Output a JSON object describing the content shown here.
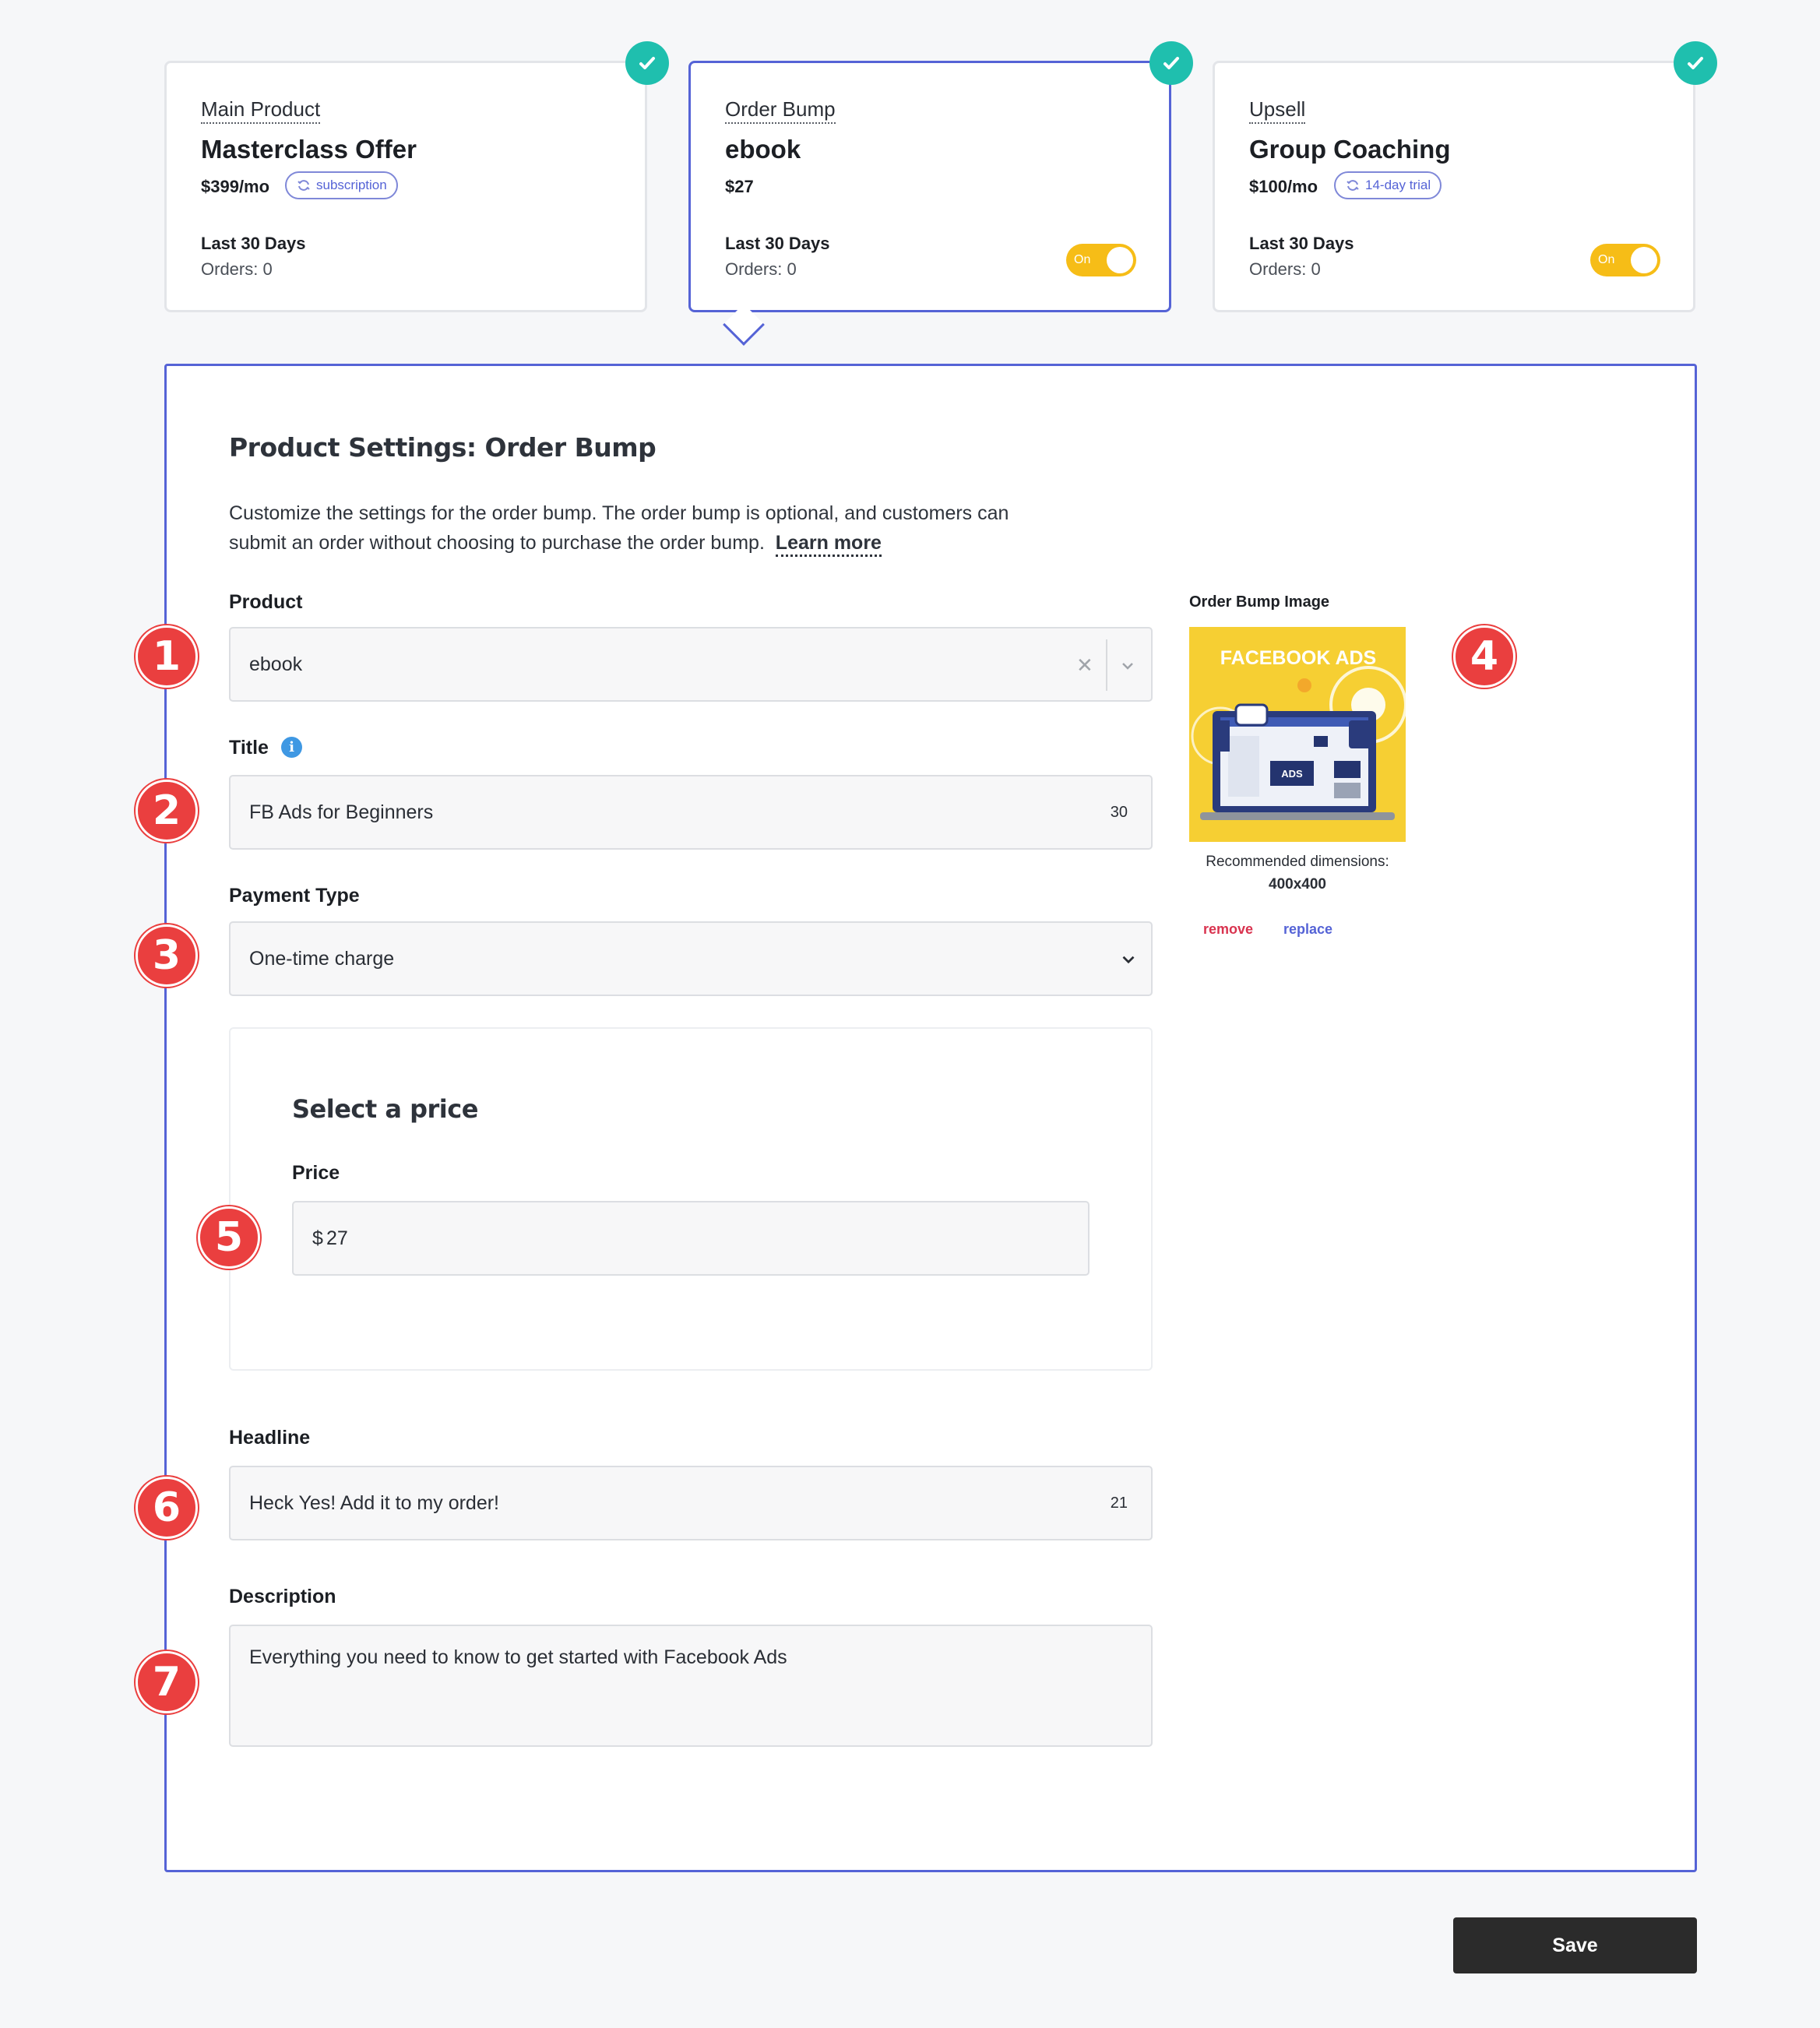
{
  "cards": [
    {
      "kind": "Main Product",
      "name": "Masterclass Offer",
      "price": "$399/mo",
      "tag": "subscription",
      "period": "Last 30 Days",
      "orders": "Orders: 0"
    },
    {
      "kind": "Order Bump",
      "name": "ebook",
      "price": "$27",
      "period": "Last 30 Days",
      "orders": "Orders: 0",
      "toggle": "On"
    },
    {
      "kind": "Upsell",
      "name": "Group Coaching",
      "price": "$100/mo",
      "tag": "14-day trial",
      "period": "Last 30 Days",
      "orders": "Orders: 0",
      "toggle": "On"
    }
  ],
  "settings": {
    "title": "Product Settings: Order Bump",
    "intro_line1": "Customize the settings for the order bump. The order bump is optional, and customers can",
    "intro_line2": "submit an order without choosing to purchase the order bump.",
    "learn_more": "Learn more"
  },
  "form": {
    "product_label": "Product",
    "product_value": "ebook",
    "title_label": "Title",
    "title_value": "FB Ads for Beginners",
    "title_count": "30",
    "payment_label": "Payment Type",
    "payment_value": "One-time charge",
    "price_section_title": "Select a price",
    "price_label": "Price",
    "price_currency": "$",
    "price_value": "27",
    "headline_label": "Headline",
    "headline_value": "Heck Yes! Add it to my order!",
    "headline_count": "21",
    "description_label": "Description",
    "description_value": "Everything you need to know to get started with Facebook Ads"
  },
  "image": {
    "label": "Order Bump Image",
    "banner_text": "FACEBOOK ADS",
    "ads_label": "ADS",
    "rec_line1": "Recommended dimensions:",
    "rec_line2": "400x400",
    "remove": "remove",
    "replace": "replace"
  },
  "markers": [
    "1",
    "2",
    "3",
    "4",
    "5",
    "6",
    "7"
  ],
  "save_label": "Save",
  "colors": {
    "accent": "#5563d6",
    "check": "#1fbfae",
    "toggle": "#f6bd17",
    "marker": "#ea3f3f",
    "remove": "#d9334f",
    "replace": "#5563d6"
  }
}
